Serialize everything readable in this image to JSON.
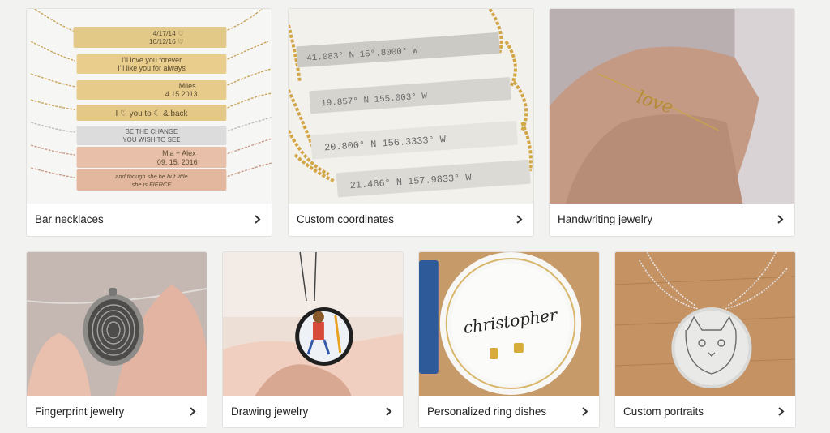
{
  "colors": {
    "page_bg": "#f2f2f0",
    "card_bg": "#ffffff",
    "text": "#222222"
  },
  "cards": [
    {
      "label": "Bar necklaces",
      "image": "gold and rose-gold engraved bar necklaces",
      "engravings": [
        "4/17/14 ♡",
        "10/12/16 ♡",
        "I'll love you forever",
        "I'll like you for always",
        "Miles",
        "4.15.2013",
        "I ♡ you to ☾ & back",
        "BE THE CHANGE",
        "YOU WISH TO SEE",
        "Mia + Alex",
        "09. 15. 2016",
        "and though she be but little",
        "she is FIERCE"
      ]
    },
    {
      "label": "Custom coordinates",
      "image": "coordinate bar necklaces",
      "engravings": [
        "41.083° N 15°.8000° W",
        "19.857° N 155.003° W",
        "20.800° N 156.3333° W",
        "21.466° N 157.9833° W"
      ]
    },
    {
      "label": "Handwriting jewelry",
      "image": "handwriting bracelet on wrist",
      "engravings": [
        "love"
      ]
    },
    {
      "label": "Fingerprint jewelry",
      "image": "fingerprint pendant held in fingers",
      "engravings": []
    },
    {
      "label": "Drawing jewelry",
      "image": "child drawing pendant",
      "engravings": []
    },
    {
      "label": "Personalized ring dishes",
      "image": "personalized ring dish",
      "engravings": [
        "christopher"
      ]
    },
    {
      "label": "Custom portraits",
      "image": "engraved cat portrait pendant",
      "engravings": []
    }
  ]
}
